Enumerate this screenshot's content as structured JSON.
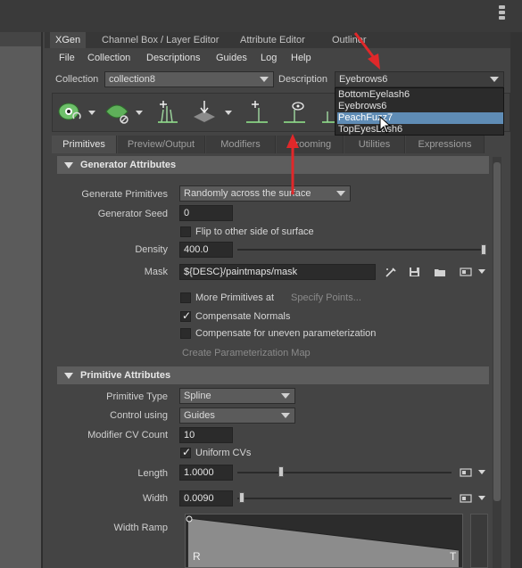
{
  "window": {
    "tabs": [
      "XGen",
      "Channel Box / Layer Editor",
      "Attribute Editor",
      "Outliner"
    ],
    "active_tab": "XGen"
  },
  "menu": [
    "File",
    "Collection",
    "Descriptions",
    "Guides",
    "Log",
    "Help"
  ],
  "collection": {
    "label": "Collection",
    "value": "collection8"
  },
  "description": {
    "label": "Description",
    "value": "Eyebrows6",
    "options": [
      "BottomEyelash6",
      "Eyebrows6",
      "PeachFuzz7",
      "TopEyesLash6"
    ],
    "highlighted": "PeachFuzz7"
  },
  "section_tabs": [
    "Primitives",
    "Preview/Output",
    "Modifiers",
    "Grooming",
    "Utilities",
    "Expressions"
  ],
  "active_section_tab": "Primitives",
  "generator": {
    "header": "Generator Attributes",
    "generate_primitives": {
      "label": "Generate Primitives",
      "value": "Randomly across the surface"
    },
    "seed": {
      "label": "Generator Seed",
      "value": "0"
    },
    "flip": {
      "label": "Flip to other side of surface",
      "checked": false
    },
    "density": {
      "label": "Density",
      "value": "400.0",
      "level": 1.0
    },
    "mask": {
      "label": "Mask",
      "value": "${DESC}/paintmaps/mask"
    },
    "more_primitives": {
      "label": "More Primitives at",
      "checked": false,
      "link": "Specify Points..."
    },
    "compensate_normals": {
      "label": "Compensate Normals",
      "checked": true
    },
    "compensate_uneven": {
      "label": "Compensate for uneven parameterization",
      "checked": false
    },
    "create_map": "Create Parameterization Map"
  },
  "primitive": {
    "header": "Primitive Attributes",
    "type": {
      "label": "Primitive Type",
      "value": "Spline"
    },
    "control": {
      "label": "Control using",
      "value": "Guides"
    },
    "cv_count": {
      "label": "Modifier CV Count",
      "value": "10"
    },
    "uniform": {
      "label": "Uniform CVs",
      "checked": true
    },
    "length": {
      "label": "Length",
      "value": "1.0000",
      "level": 0.19
    },
    "width": {
      "label": "Width",
      "value": "0.0090",
      "level": 0.01
    },
    "width_ramp": {
      "label": "Width Ramp",
      "left": "R",
      "right": "T"
    }
  },
  "icons": {
    "toolbar": [
      "eye-create-icon",
      "leaf-delete-icon",
      "plant-add-icon",
      "arrow-placement-icon",
      "add-guide-icon",
      "guide-eye-icon"
    ],
    "mask_tools": [
      "paint-brush-icon",
      "save-icon",
      "folder-icon",
      "map-icon"
    ]
  },
  "colors": {
    "accent": "#5f8cb5",
    "annotation": "#e0282a"
  }
}
